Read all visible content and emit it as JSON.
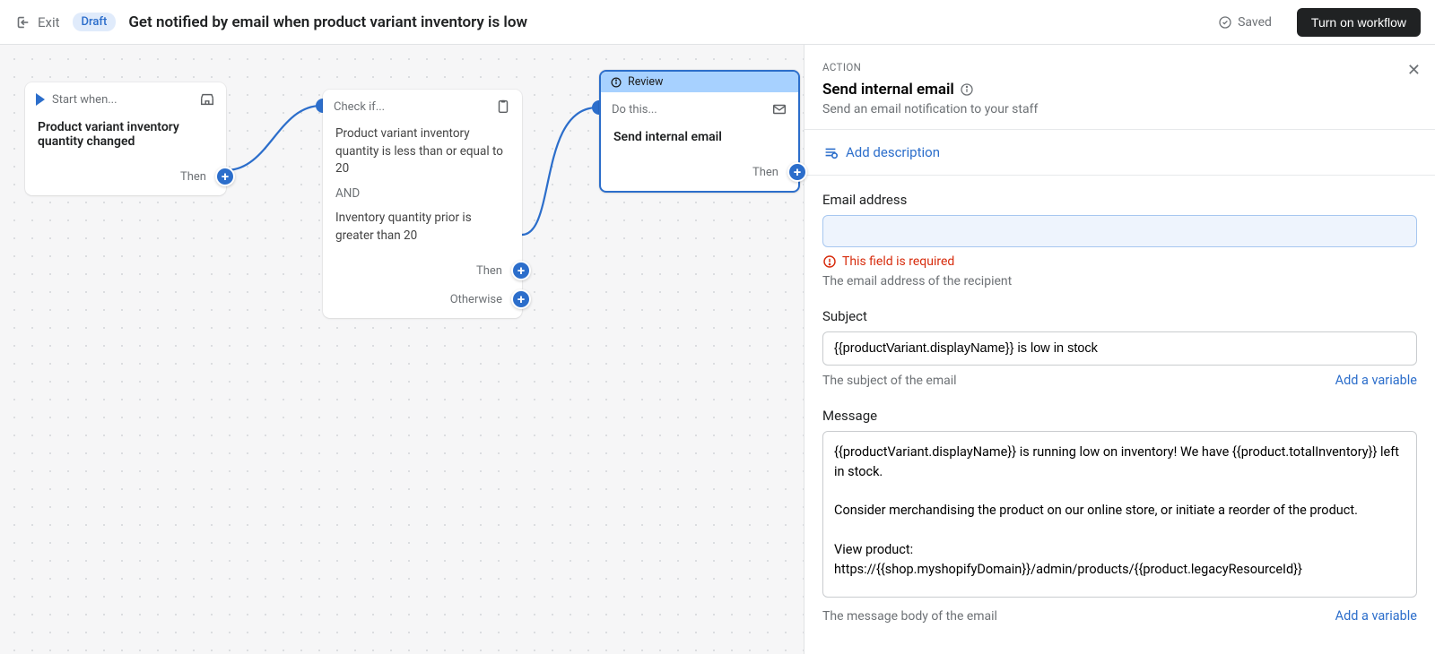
{
  "header": {
    "exit": "Exit",
    "badge": "Draft",
    "title": "Get notified by email when product variant inventory is low",
    "saved": "Saved",
    "turn_on": "Turn on workflow"
  },
  "canvas": {
    "trigger": {
      "head": "Start when...",
      "title": "Product variant inventory quantity changed",
      "then": "Then"
    },
    "condition": {
      "head": "Check if...",
      "line1": "Product variant inventory quantity is less than or equal to 20",
      "and": "AND",
      "line2": "Inventory quantity prior is greater than 20",
      "then": "Then",
      "otherwise": "Otherwise"
    },
    "action": {
      "review": "Review",
      "head": "Do this...",
      "title": "Send internal email",
      "then": "Then"
    }
  },
  "panel": {
    "section_label": "ACTION",
    "title": "Send internal email",
    "subtitle": "Send an email notification to your staff",
    "add_description": "Add description",
    "email": {
      "label": "Email address",
      "error": "This field is required",
      "helper": "The email address of the recipient",
      "value": ""
    },
    "subject": {
      "label": "Subject",
      "value": "{{productVariant.displayName}} is low in stock",
      "helper": "The subject of the email",
      "add_var": "Add a variable"
    },
    "message": {
      "label": "Message",
      "value": "{{productVariant.displayName}} is running low on inventory! We have {{product.totalInventory}} left in stock.\n\nConsider merchandising the product on our online store, or initiate a reorder of the product.\n\nView product:\nhttps://{{shop.myshopifyDomain}}/admin/products/{{product.legacyResourceId}}",
      "helper": "The message body of the email",
      "add_var": "Add a variable"
    }
  }
}
